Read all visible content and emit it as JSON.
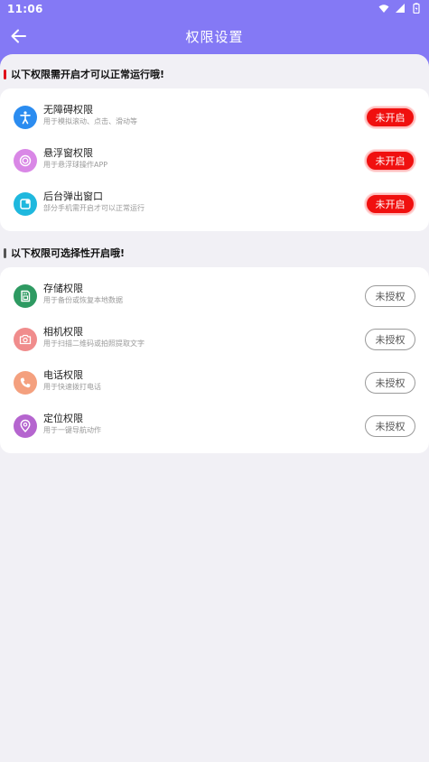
{
  "status_bar": {
    "time": "11:06"
  },
  "nav": {
    "title": "权限设置"
  },
  "required_section": {
    "title": "以下权限需开启才可以正常运行哦!",
    "items": [
      {
        "title": "无障碍权限",
        "subtitle": "用于模拟滚动、点击、滑动等",
        "button": "未开启",
        "icon": "accessibility-icon",
        "color": "#2b8cf0"
      },
      {
        "title": "悬浮窗权限",
        "subtitle": "用于悬浮球操作APP",
        "button": "未开启",
        "icon": "floating-window-icon",
        "color": "#d987e6"
      },
      {
        "title": "后台弹出窗口",
        "subtitle": "部分手机需开启才可以正常运行",
        "button": "未开启",
        "icon": "background-popup-icon",
        "color": "#1fb8de"
      }
    ]
  },
  "optional_section": {
    "title": "以下权限可选择性开启哦!",
    "items": [
      {
        "title": "存储权限",
        "subtitle": "用于备份或恢复本地数据",
        "button": "未授权",
        "icon": "storage-icon",
        "color": "#2e9a62"
      },
      {
        "title": "相机权限",
        "subtitle": "用于扫描二维码或拍照提取文字",
        "button": "未授权",
        "icon": "camera-icon",
        "color": "#f08c8c"
      },
      {
        "title": "电话权限",
        "subtitle": "用于快速拨打电话",
        "button": "未授权",
        "icon": "phone-icon",
        "color": "#f4a07e"
      },
      {
        "title": "定位权限",
        "subtitle": "用于一键导航动作",
        "button": "未授权",
        "icon": "location-icon",
        "color": "#b565cf"
      }
    ]
  },
  "colors": {
    "header": "#8479f5",
    "required_marker": "#e0101a",
    "optional_marker": "#555555",
    "enable_button": "#f0100f"
  }
}
